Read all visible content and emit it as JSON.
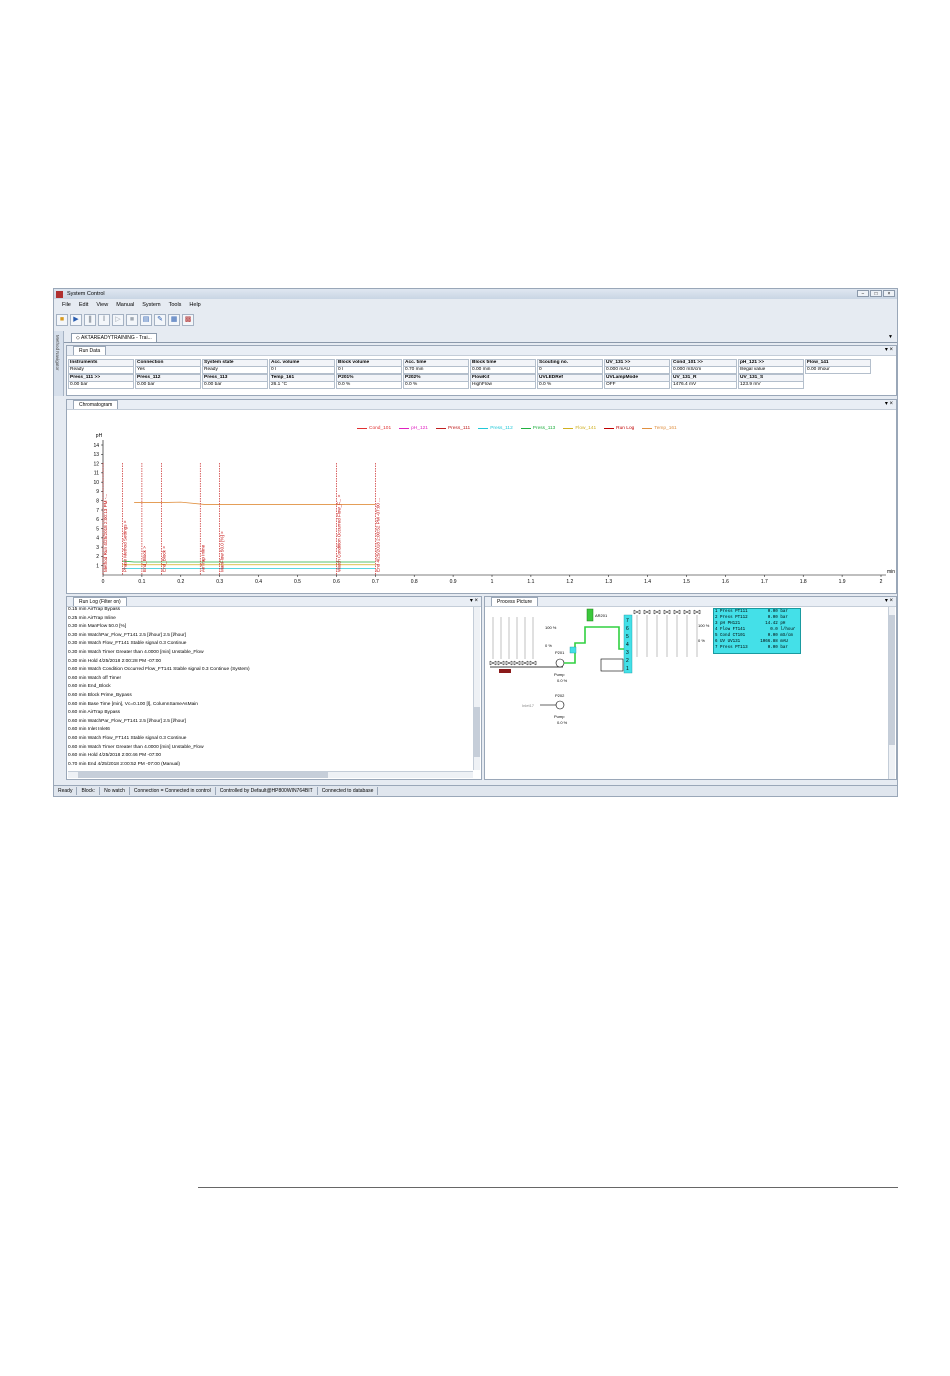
{
  "window": {
    "title": "System Control",
    "buttons": [
      "−",
      "□",
      "×"
    ]
  },
  "menu": [
    "File",
    "Edit",
    "View",
    "Manual",
    "System",
    "Tools",
    "Help"
  ],
  "sidebar": {
    "label": "Method Navigator"
  },
  "document_tab": "AKTAREADYTRAINING - Trai...",
  "run_data": {
    "tab": "Run Data",
    "row1": [
      {
        "h": "Instruments",
        "v": "Ready"
      },
      {
        "h": "Connection",
        "v": "Yes"
      },
      {
        "h": "System state",
        "v": "Ready"
      },
      {
        "h": "Acc. volume",
        "v": "0 l"
      },
      {
        "h": "Block volume",
        "v": "0 l"
      },
      {
        "h": "Acc. time",
        "v": "0.70 min"
      },
      {
        "h": "Block time",
        "v": "0.00 min"
      },
      {
        "h": "Scouting no.",
        "v": "0"
      },
      {
        "h": "UV_131  >>",
        "v": "0.000 mAU"
      },
      {
        "h": "Cond_101  >>",
        "v": "0.000 mS/cm"
      },
      {
        "h": "pH_121  >>",
        "v": "Illegal value"
      },
      {
        "h": "Flow_141",
        "v": "0.00 l/hour"
      }
    ],
    "row2": [
      {
        "h": "Press_111  >>",
        "v": "0.00 bar"
      },
      {
        "h": "Press_112",
        "v": "0.00 bar"
      },
      {
        "h": "Press_113",
        "v": "0.00 bar"
      },
      {
        "h": "Temp_161",
        "v": "26.1 °C"
      },
      {
        "h": "P201%",
        "v": "0.0 %"
      },
      {
        "h": "P202%",
        "v": "0.0 %"
      },
      {
        "h": "FlowKit",
        "v": "HighFlow"
      },
      {
        "h": "UVLEDRef",
        "v": "0.0 %"
      },
      {
        "h": "UVLampMode",
        "v": "OFF"
      },
      {
        "h": "UV_131_R",
        "v": "1476.4 mV"
      },
      {
        "h": "UV_131_S",
        "v": "123.9 mV"
      }
    ]
  },
  "chromatogram": {
    "tab": "Chromatogram",
    "legend": [
      {
        "name": "Cond_101",
        "color": "#e03030"
      },
      {
        "name": "pH_121",
        "color": "#e020c0"
      },
      {
        "name": "Press_111",
        "color": "#c02020"
      },
      {
        "name": "Press_112",
        "color": "#20c8d8"
      },
      {
        "name": "Press_113",
        "color": "#20b040"
      },
      {
        "name": "Flow_141",
        "color": "#d0b020"
      },
      {
        "name": "Run Log",
        "color": "#c00000"
      },
      {
        "name": "Temp_161",
        "color": "#e09040"
      }
    ]
  },
  "chart_data": {
    "type": "line",
    "ylabel": "pH",
    "xlabel": "min",
    "xlim": [
      0,
      2
    ],
    "ylim": [
      0,
      14
    ],
    "xticks": [
      "0",
      "0.1",
      "0.2",
      "0.3",
      "0.4",
      "0.5",
      "0.6",
      "0.7",
      "0.8",
      "0.9",
      "1",
      "1.1",
      "1.2",
      "1.3",
      "1.4",
      "1.5",
      "1.6",
      "1.7",
      "1.8",
      "1.9",
      "2"
    ],
    "yticks": [
      "1",
      "2",
      "3",
      "4",
      "5",
      "6",
      "7",
      "8",
      "9",
      "10",
      "11",
      "12",
      "13",
      "14"
    ],
    "series": [
      {
        "name": "Temp_161",
        "color": "#e09040",
        "x": [
          0.08,
          0.15,
          0.2,
          0.26,
          0.7
        ],
        "y": [
          7.8,
          7.8,
          7.85,
          7.6,
          7.6
        ]
      },
      {
        "name": "Press_113",
        "color": "#20b040",
        "x": [
          0.05,
          0.08,
          0.7
        ],
        "y": [
          1.5,
          1.4,
          1.4
        ]
      },
      {
        "name": "Press_112",
        "color": "#20c8d8",
        "x": [
          0.05,
          0.7
        ],
        "y": [
          0.7,
          0.7
        ]
      },
      {
        "name": "Flow_141",
        "color": "#d0b020",
        "x": [
          0.05,
          0.7
        ],
        "y": [
          1.1,
          1.1
        ]
      }
    ],
    "annotations": [
      {
        "x": 0.0,
        "label": "Method Run 4/25/2018 2:00:13 PM -..."
      },
      {
        "x": 0.05,
        "label": "Phase Method Settings  >"
      },
      {
        "x": 0.1,
        "label": "End_Block  >"
      },
      {
        "x": 0.15,
        "label": "End_Block  >"
      },
      {
        "x": 0.25,
        "label": "AirTrap Inline"
      },
      {
        "x": 0.3,
        "label": "ManFlow 50.0 [%]  >"
      },
      {
        "x": 0.6,
        "label": "Watch Condition Occurred Flow_F...  >"
      },
      {
        "x": 0.7,
        "label": "End 4/25/2018 2:00:52 PM -07:00 ..."
      }
    ]
  },
  "run_log": {
    "tab": "Run Log (Filter on)",
    "lines": [
      "0.15 min AirTrap Bypass",
      "0.25 min AirTrap Inline",
      "0.30 min ManFlow 50.0 [%]",
      "0.30 min WatchPar_Flow_FT141 2.5 [l/hour] 2.5 [l/hour]",
      "0.30 min Watch Flow_FT141 Stable signal 0.3 Continue",
      "0.30 min Watch Timer Greater than 4.0000 [min] Unstable_Flow",
      "0.30 min Hold 4/25/2018 2:00:28 PM -07:00",
      "0.60 min Watch Condition Occurred Flow_FT141 Stable signal 0.3 Continue (System)",
      "0.60 min Watch off Timer",
      "0.60 min End_Block",
      "0.60 min Block Prime_Bypass",
      "0.60 min Base Time [min], Vc=0.100 [l], ColumnSameAsMain",
      "0.60 min AirTrap Bypass",
      "0.60 min WatchPar_Flow_FT141 2.5 [l/hour] 2.5 [l/hour]",
      "0.60 min Inlet Inlet6",
      "0.60 min Watch Flow_FT141 Stable signal 0.3 Continue",
      "0.60 min Watch Timer Greater than 4.0000 [min] Unstable_Flow",
      "0.60 min Hold 4/25/2018 2:00:46 PM -07:00",
      "0.70 min End 4/25/2018 2:00:52 PM -07:00 (Manual)"
    ]
  },
  "process_picture": {
    "tab": "Process Picture",
    "p201": "P201",
    "p202": "P202",
    "pump": "Pump",
    "zero_pct": "0.0 %",
    "pct100": "100 %",
    "zero": "0 %",
    "inlet": "Inlet17",
    "airtrap": "AR201",
    "readout": [
      "1 Press PT111        0.00 bar",
      "2 Press PT112        0.00 bar",
      "3 pH PH121          14.42 pH",
      "4 Flow FT141          0.0 l/hour",
      "5 Cond CT101         0.00 mS/cm",
      "6 UV UV131        1066.88 mAU",
      "7 Press PT113        0.00 bar"
    ],
    "numbers": [
      "7",
      "6",
      "5",
      "4",
      "3",
      "2",
      "1"
    ]
  },
  "statusbar": [
    "Ready",
    "Block:",
    "No watch",
    "Connection = Connected in control",
    "Controlled by Default@HP800WIN764BIT",
    "Connected to database"
  ]
}
